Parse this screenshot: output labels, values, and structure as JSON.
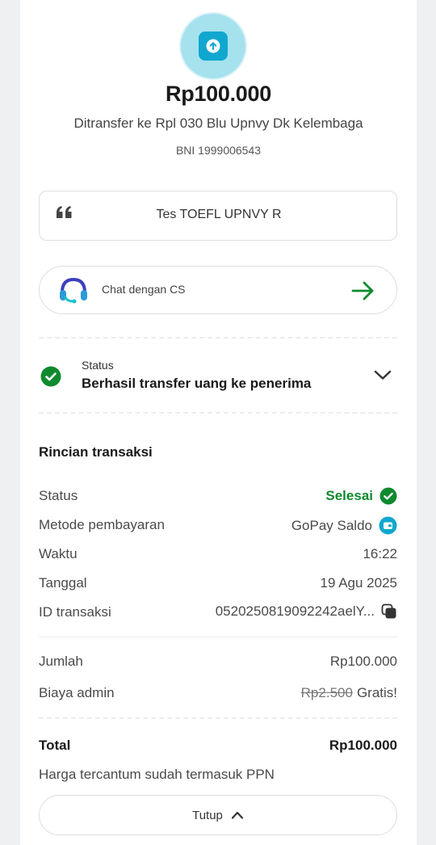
{
  "transaction": {
    "icon": "upload-arrow-icon",
    "amount": "Rp100.000",
    "recipient": "Ditransfer ke Rpl 030 Blu Upnvy Dk Kelembaga",
    "account": "BNI 1999006543"
  },
  "note": {
    "icon": "quote-icon",
    "text": "Tes TOEFL UPNVY R"
  },
  "cs": {
    "icon": "headset-icon",
    "label": "Chat dengan CS",
    "arrow_icon": "arrow-right-icon"
  },
  "status": {
    "caption": "Status",
    "value": "Berhasil transfer uang ke penerima"
  },
  "details": {
    "title": "Rincian transaksi",
    "status_label": "Status",
    "status_value": "Selesai",
    "method_label": "Metode pembayaran",
    "method_value": "GoPay Saldo",
    "time_label": "Waktu",
    "time_value": "16:22",
    "date_label": "Tanggal",
    "date_value": "19 Agu 2025",
    "id_label": "ID transaksi",
    "id_value": "0520250819092242aelY...",
    "amount_label": "Jumlah",
    "amount_value": "Rp100.000",
    "fee_label": "Biaya admin",
    "fee_original": "Rp2.500",
    "fee_value": "Gratis!",
    "total_label": "Total",
    "total_value": "Rp100.000",
    "ppn_note": "Harga tercantum sudah termasuk PPN"
  },
  "close_button": {
    "label": "Tutup"
  },
  "colors": {
    "accent_green": "#0f8a2e",
    "accent_blue": "#10a7cf",
    "icon_ring": "#a6e1ee"
  }
}
